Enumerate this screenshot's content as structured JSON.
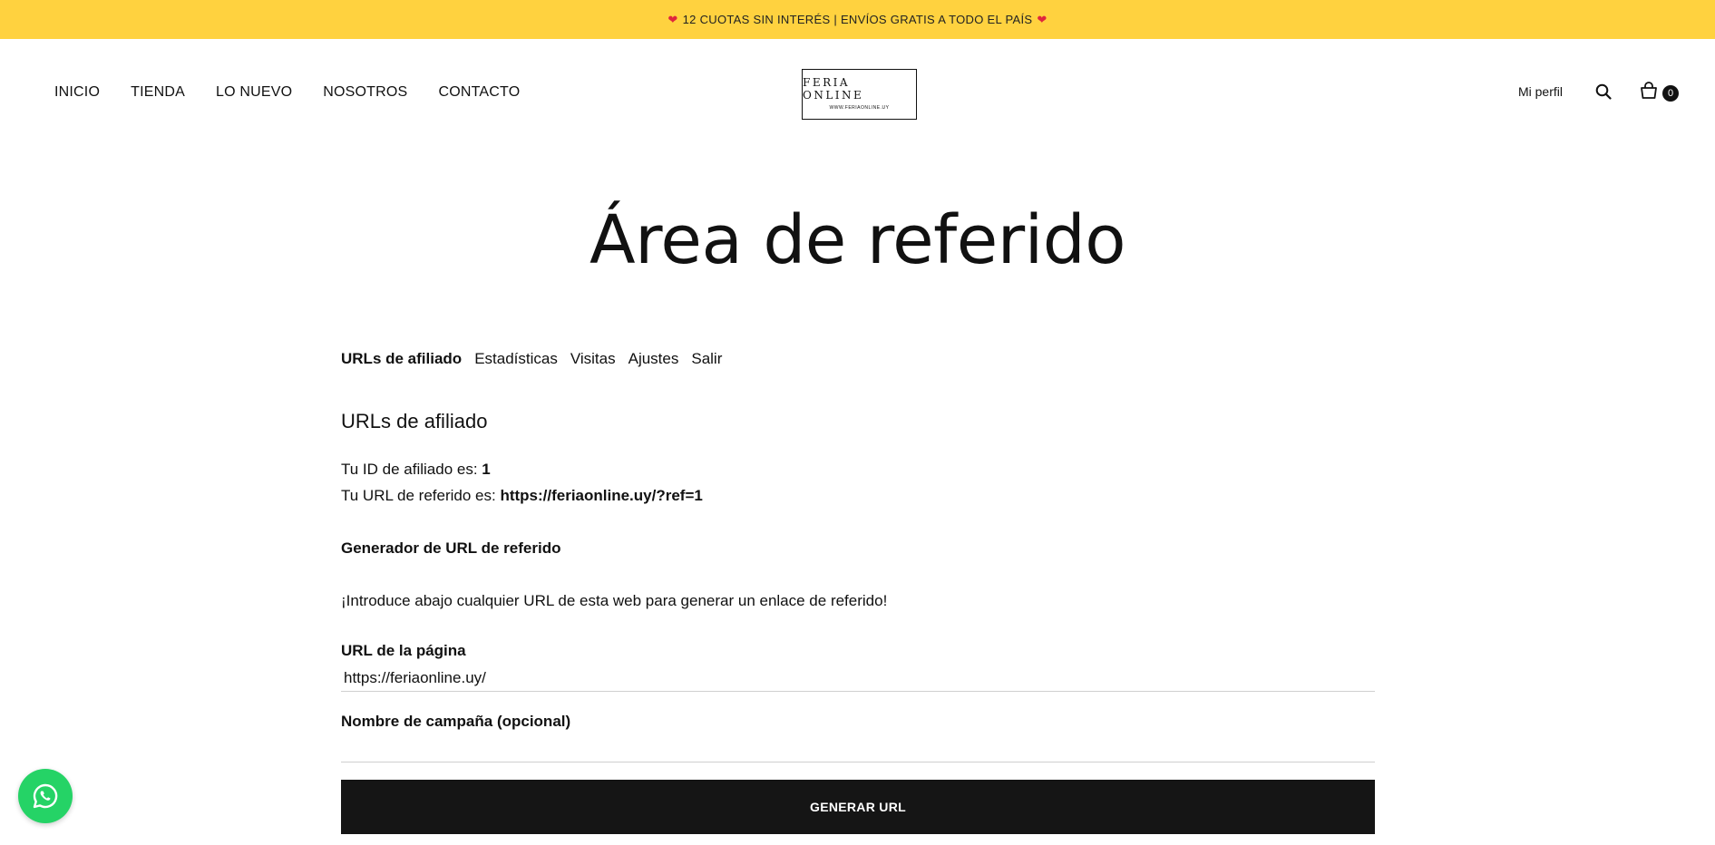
{
  "announcement": {
    "text": "12 CUOTAS SIN INTERÉS | ENVÍOS GRATIS A TODO EL PAÍS",
    "heart": "❤",
    "bg_color": "#ffd23f"
  },
  "header": {
    "nav": [
      "INICIO",
      "TIENDA",
      "LO NUEVO",
      "NOSOTROS",
      "CONTACTO"
    ],
    "logo_text": "FERIA ONLINE",
    "logo_sub": "WWW.FERIAONLINE.UY",
    "profile_label": "Mi perfil",
    "cart_count": "0"
  },
  "page": {
    "title": "Área de referido"
  },
  "tabs": [
    "URLs de afiliado",
    "Estadísticas",
    "Visitas",
    "Ajustes",
    "Salir"
  ],
  "affiliate": {
    "section_title": "URLs de afiliado",
    "id_label": "Tu ID de afiliado es: ",
    "id_value": "1",
    "url_label": "Tu URL de referido es: ",
    "url_value": "https://feriaonline.uy/?ref=1",
    "generator_title": "Generador de URL de referido",
    "intro": "¡Introduce abajo cualquier URL de esta web para generar un enlace de referido!",
    "page_url_label": "URL de la página",
    "page_url_value": "https://feriaonline.uy/",
    "campaign_label": "Nombre de campaña (opcional)",
    "campaign_value": "",
    "button_label": "GENERAR URL"
  },
  "whatsapp": {
    "icon": "whatsapp-icon",
    "color": "#25d366"
  }
}
